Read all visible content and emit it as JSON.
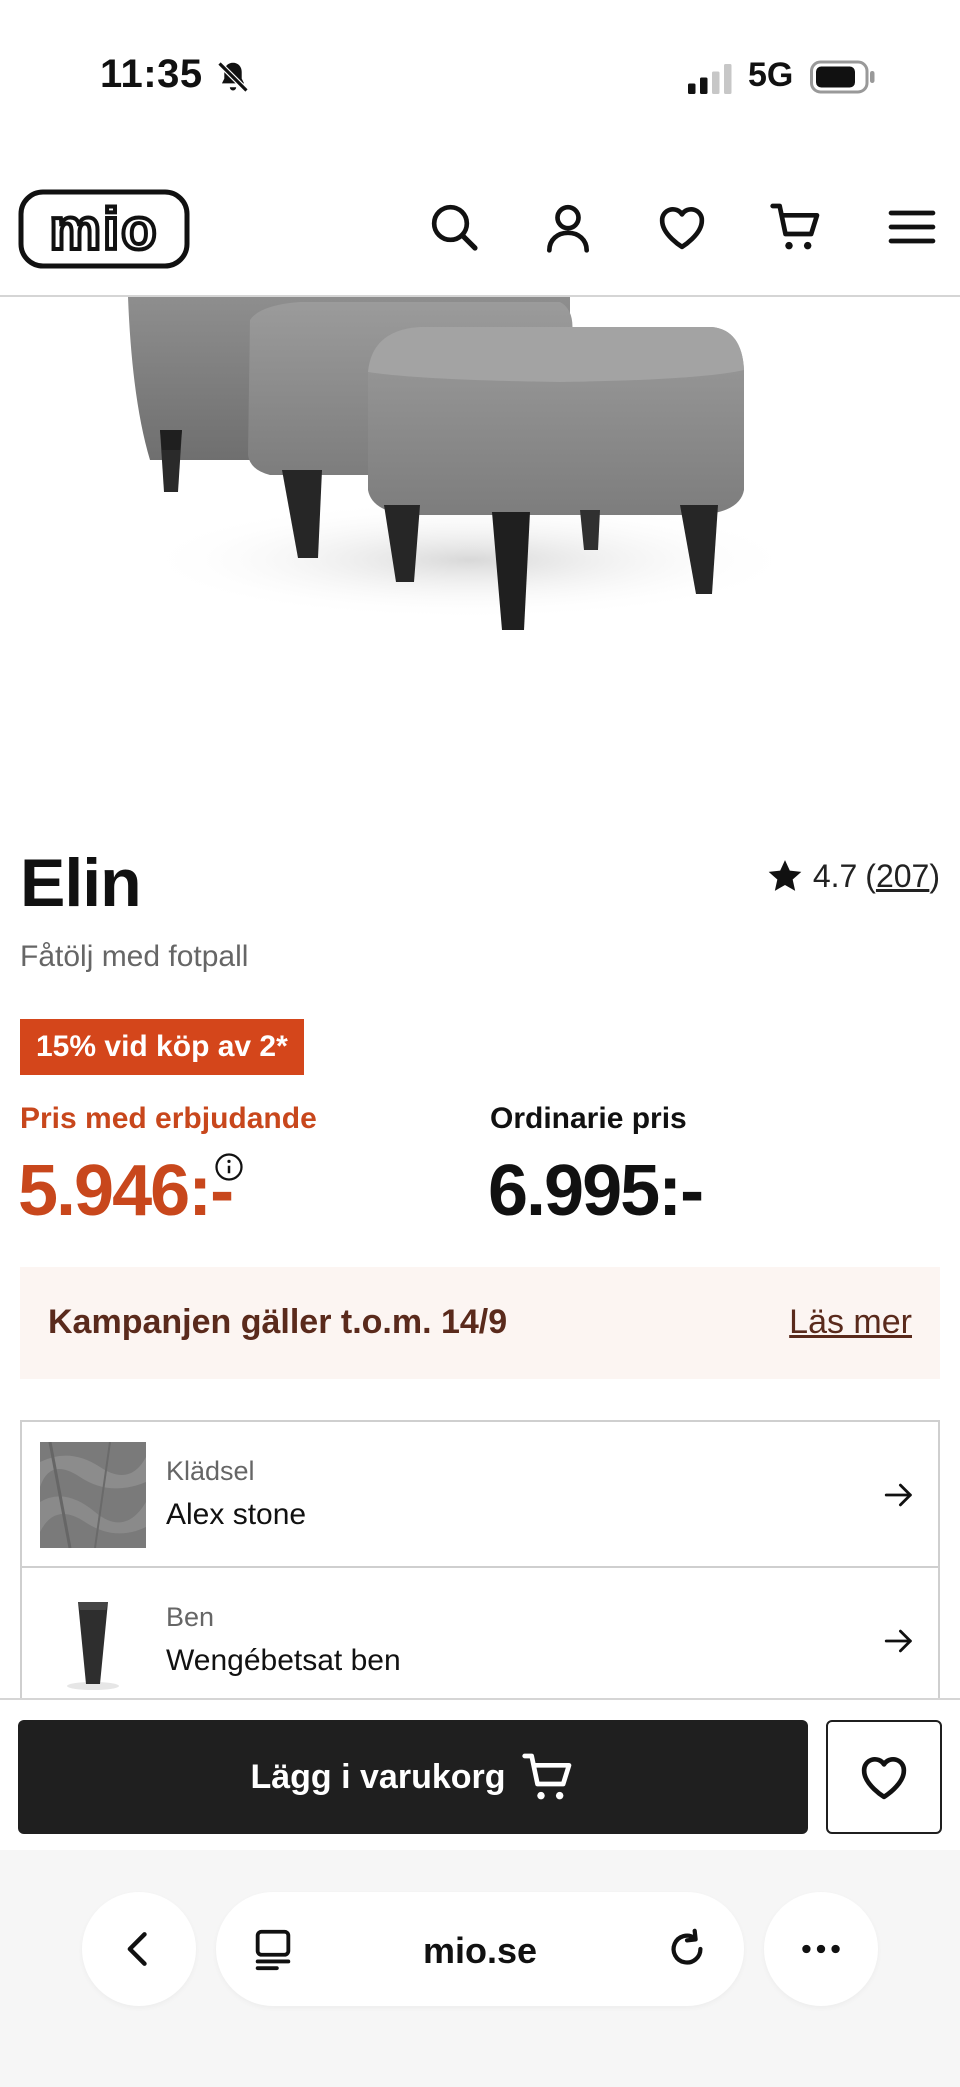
{
  "status_bar": {
    "time": "11:35",
    "network": "5G"
  },
  "header": {
    "logo_text": "mio",
    "icons": [
      "search-icon",
      "account-icon",
      "heart-icon",
      "cart-icon",
      "menu-icon"
    ]
  },
  "product": {
    "title": "Elin",
    "subtitle": "Fåtölj med fotpall",
    "rating_value": "4.7",
    "rating_open": "(",
    "rating_count": "207",
    "rating_close": ")",
    "promo_badge": "15% vid köp av 2*",
    "offer_label": "Pris med erbjudande",
    "offer_price": "5.946:-",
    "regular_label": "Ordinarie pris",
    "regular_price": "6.995:-"
  },
  "campaign": {
    "text": "Kampanjen gäller t.o.m. 14/9",
    "link": "Läs mer"
  },
  "options": [
    {
      "label": "Klädsel",
      "value": "Alex stone"
    },
    {
      "label": "Ben",
      "value": "Wengébetsat ben"
    }
  ],
  "actions": {
    "add_to_cart": "Lägg i varukorg"
  },
  "browser": {
    "url": "mio.se"
  },
  "colors": {
    "accent": "#c8471c",
    "badge": "#d4461b",
    "campaign_bg": "#fcf5f2",
    "campaign_text": "#5a2a1c",
    "button_dark": "#1f1f1f"
  }
}
